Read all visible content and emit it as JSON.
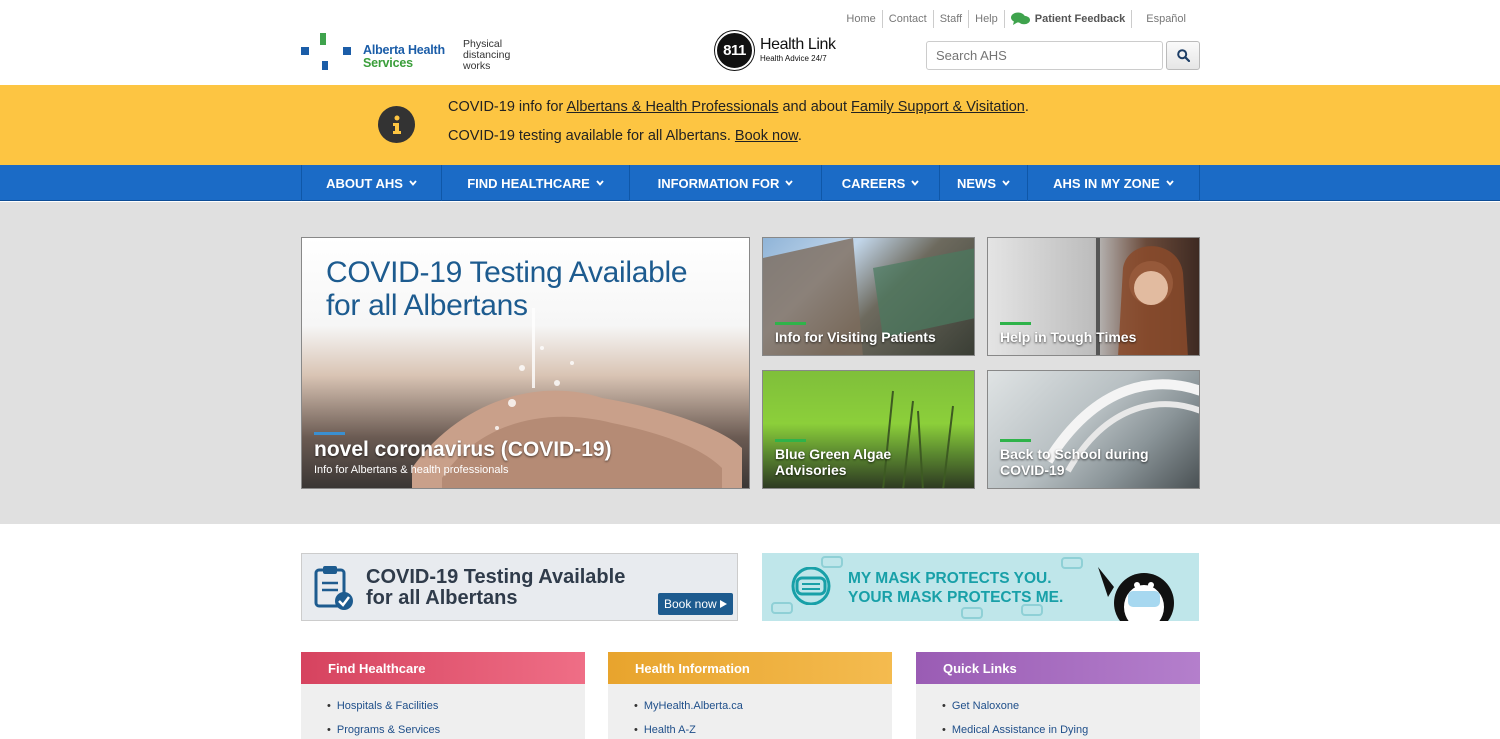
{
  "utility": {
    "home": "Home",
    "contact": "Contact",
    "staff": "Staff",
    "help": "Help",
    "feedback": "Patient Feedback",
    "espanol": "Español"
  },
  "header": {
    "logo_line1": "Alberta Health",
    "logo_line2": "Services",
    "distancing_1": "Physical",
    "distancing_2": "distancing",
    "distancing_3": "works",
    "healthlink_num": "811",
    "healthlink_title": "Health Link",
    "healthlink_sub": "Health Advice 24/7",
    "search_placeholder": "Search AHS"
  },
  "alert": {
    "line1_prefix": "COVID-19 info for ",
    "line1_link1": "Albertans & Health Professionals",
    "line1_mid": " and about ",
    "line1_link2": "Family Support & Visitation",
    "line1_suffix": ".",
    "line2_prefix": "COVID-19 testing available for all Albertans. ",
    "line2_link": "Book now",
    "line2_suffix": "."
  },
  "nav": [
    {
      "label": "About AHS"
    },
    {
      "label": "Find Healthcare"
    },
    {
      "label": "Information For"
    },
    {
      "label": "Careers"
    },
    {
      "label": "News"
    },
    {
      "label": "AHS in My Zone"
    }
  ],
  "hero": {
    "main_title_1": "COVID-19 Testing Available",
    "main_title_2": "for all Albertans",
    "main_caption": "novel coronavirus (COVID-19)",
    "main_sub": "Info for Albertans & health professionals",
    "tiles": [
      {
        "caption": "Info for Visiting Patients"
      },
      {
        "caption": "Help in Tough Times"
      },
      {
        "caption_1": "Blue Green Algae",
        "caption_2": "Advisories"
      },
      {
        "caption_1": "Back to School during",
        "caption_2": "COVID-19"
      }
    ]
  },
  "promos": {
    "testing_1": "COVID-19 Testing Available",
    "testing_2": "for all Albertans",
    "book_now": "Book now",
    "mask_1": "MY MASK PROTECTS YOU.",
    "mask_2": "YOUR MASK PROTECTS ME."
  },
  "columns": [
    {
      "title": "Find Healthcare",
      "color": "#d6435f",
      "items": [
        "Hospitals & Facilities",
        "Programs & Services"
      ]
    },
    {
      "title": "Health Information",
      "color": "#e8a42d",
      "items": [
        "MyHealth.Alberta.ca",
        "Health A-Z"
      ]
    },
    {
      "title": "Quick Links",
      "color": "#9a5cb4",
      "items": [
        "Get Naloxone",
        "Medical Assistance in Dying"
      ]
    }
  ]
}
